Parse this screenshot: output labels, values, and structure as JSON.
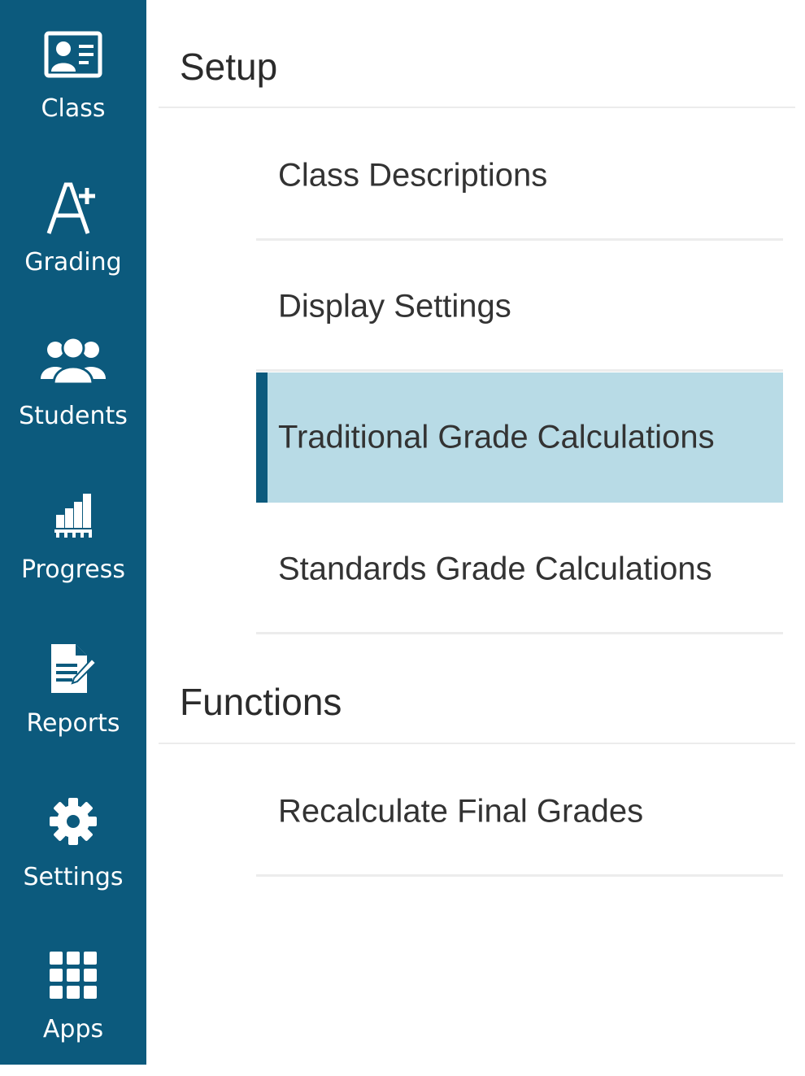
{
  "sidebar": {
    "items": [
      {
        "label": "Class",
        "icon": "class-card-icon"
      },
      {
        "label": "Grading",
        "icon": "a-plus-icon"
      },
      {
        "label": "Students",
        "icon": "students-group-icon"
      },
      {
        "label": "Progress",
        "icon": "progress-chart-icon"
      },
      {
        "label": "Reports",
        "icon": "report-document-icon"
      },
      {
        "label": "Settings",
        "icon": "gear-icon"
      },
      {
        "label": "Apps",
        "icon": "apps-grid-icon"
      }
    ],
    "colors": {
      "background": "#0c5a7d",
      "text": "#ffffff"
    }
  },
  "sections": [
    {
      "title": "Setup",
      "items": [
        {
          "label": "Class Descriptions"
        },
        {
          "label": "Display Settings"
        },
        {
          "label": "Traditional Grade Calculations",
          "active": true
        },
        {
          "label": "Standards Grade Calculations"
        }
      ]
    },
    {
      "title": "Functions",
      "items": [
        {
          "label": "Recalculate Final Grades"
        }
      ]
    }
  ],
  "colors": {
    "active_background": "#b8dbe6",
    "active_accent": "#0c5a7d"
  }
}
